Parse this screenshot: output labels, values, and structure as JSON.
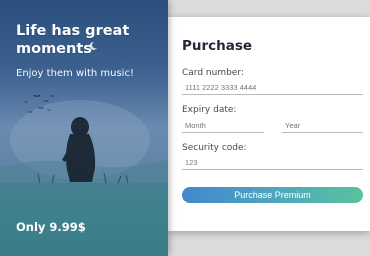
{
  "promo": {
    "title": "Life has great moments",
    "subtitle": "Enjoy them with music!",
    "price": "Only 9.99$",
    "art_icon": "moonlit-silhouette-illustration"
  },
  "purchase": {
    "title": "Purchase",
    "card_number": {
      "label": "Card number:",
      "placeholder": "1111 2222 3333 4444"
    },
    "expiry": {
      "label": "Expiry date:",
      "month_placeholder": "Month",
      "year_placeholder": "Year"
    },
    "security": {
      "label": "Security code:",
      "placeholder": "123"
    },
    "button_label": "Purchase Premium"
  },
  "colors": {
    "promo_top": "#2a4f7c",
    "promo_bottom": "#2f7d84",
    "button_start": "#4188cd",
    "button_end": "#5bc29b",
    "title_text": "#222a36"
  }
}
